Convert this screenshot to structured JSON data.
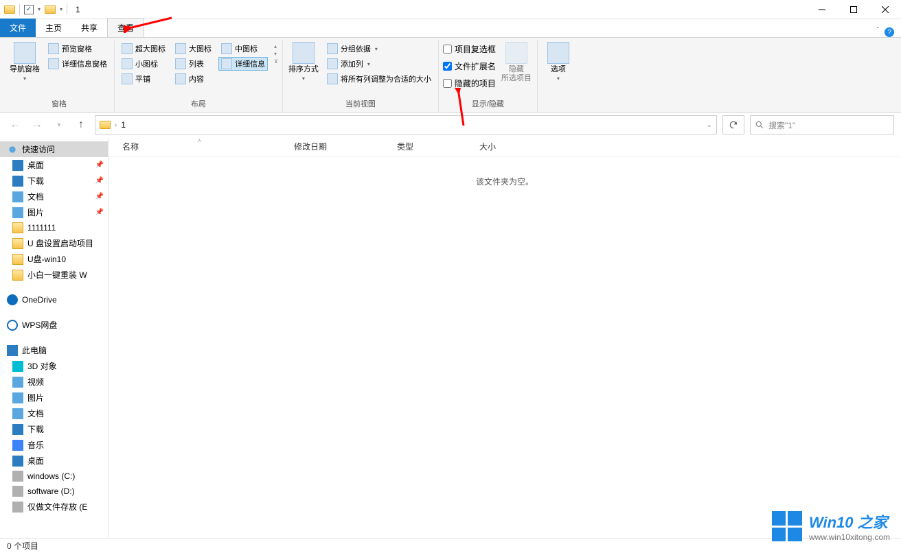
{
  "title": "1",
  "tabs": {
    "file": "文件",
    "home": "主页",
    "share": "共享",
    "view": "查看"
  },
  "ribbon": {
    "panes": {
      "nav": "导航窗格",
      "preview": "预览窗格",
      "details": "详细信息窗格",
      "group_label": "窗格"
    },
    "layout": {
      "xl": "超大图标",
      "lg": "大图标",
      "md": "中图标",
      "sm": "小图标",
      "list": "列表",
      "detail": "详细信息",
      "tile": "平铺",
      "content": "内容",
      "group_label": "布局"
    },
    "view": {
      "sort": "排序方式",
      "group": "分组依据",
      "addcol": "添加列",
      "fitcols": "将所有列调整为合适的大小",
      "group_label": "当前视图"
    },
    "showhide": {
      "checkboxes": "项目复选框",
      "ext": "文件扩展名",
      "hidden": "隐藏的项目",
      "hide_btn": "隐藏\n所选项目",
      "group_label": "显示/隐藏"
    },
    "options": "选项"
  },
  "breadcrumb": "1",
  "search_placeholder": "搜索\"1\"",
  "columns": {
    "name": "名称",
    "date": "修改日期",
    "type": "类型",
    "size": "大小"
  },
  "empty_text": "该文件夹为空。",
  "tree": {
    "quick": "快速访问",
    "desktop": "桌面",
    "downloads": "下载",
    "documents": "文档",
    "pictures": "图片",
    "f1": "1111111",
    "f2": "U 盘设置启动项目",
    "f3": "U盘-win10",
    "f4": "小白一键重装 W",
    "onedrive": "OneDrive",
    "wps": "WPS网盘",
    "thispc": "此电脑",
    "obj3d": "3D 对象",
    "videos": "视频",
    "pictures2": "图片",
    "documents2": "文档",
    "downloads2": "下载",
    "music": "音乐",
    "desktop2": "桌面",
    "drive_c": "windows (C:)",
    "drive_d": "software (D:)",
    "drive_e": "仅做文件存放 (E"
  },
  "status": "0 个项目",
  "watermark": {
    "line1": "Win10 之家",
    "line2": "www.win10xitong.com"
  }
}
